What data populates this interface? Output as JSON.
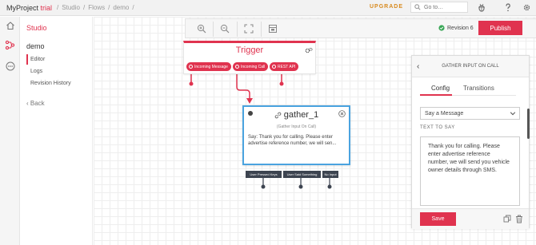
{
  "header": {
    "brand": "MyProject",
    "trial": "trial",
    "breadcrumbs": [
      "/",
      "Studio",
      "/",
      "Flows",
      "/",
      "demo",
      "/"
    ],
    "upgrade": "UPGRADE",
    "goto_placeholder": "Go to…"
  },
  "nav": {
    "section": "Studio",
    "flow_name": "demo",
    "items": [
      "Editor",
      "Logs",
      "Revision History"
    ],
    "back": "‹ Back"
  },
  "toolbar": {
    "revision": "Revision 6",
    "publish": "Publish"
  },
  "trigger": {
    "title": "Trigger",
    "outputs": [
      "Incoming Message",
      "Incoming Call",
      "REST API"
    ]
  },
  "widget": {
    "name": "gather_1",
    "type": "(Gather Input On Call)",
    "body": "Say: Thank you for calling. Please enter advertise reference number, we will sen...",
    "outputs": [
      "User Pressed Keys",
      "User Said Something",
      "No Input"
    ]
  },
  "panel": {
    "title": "GATHER INPUT ON CALL",
    "tabs": [
      "Config",
      "Transitions"
    ],
    "mode": "Say a Message",
    "field_label": "TEXT TO SAY",
    "text": "Thank you for calling. Please enter advertise reference number, we will send you vehicle owner details through SMS.",
    "save": "Save"
  },
  "colors": {
    "accent": "#e0334f",
    "selection": "#4aa3df",
    "status_ok": "#3aa757"
  }
}
